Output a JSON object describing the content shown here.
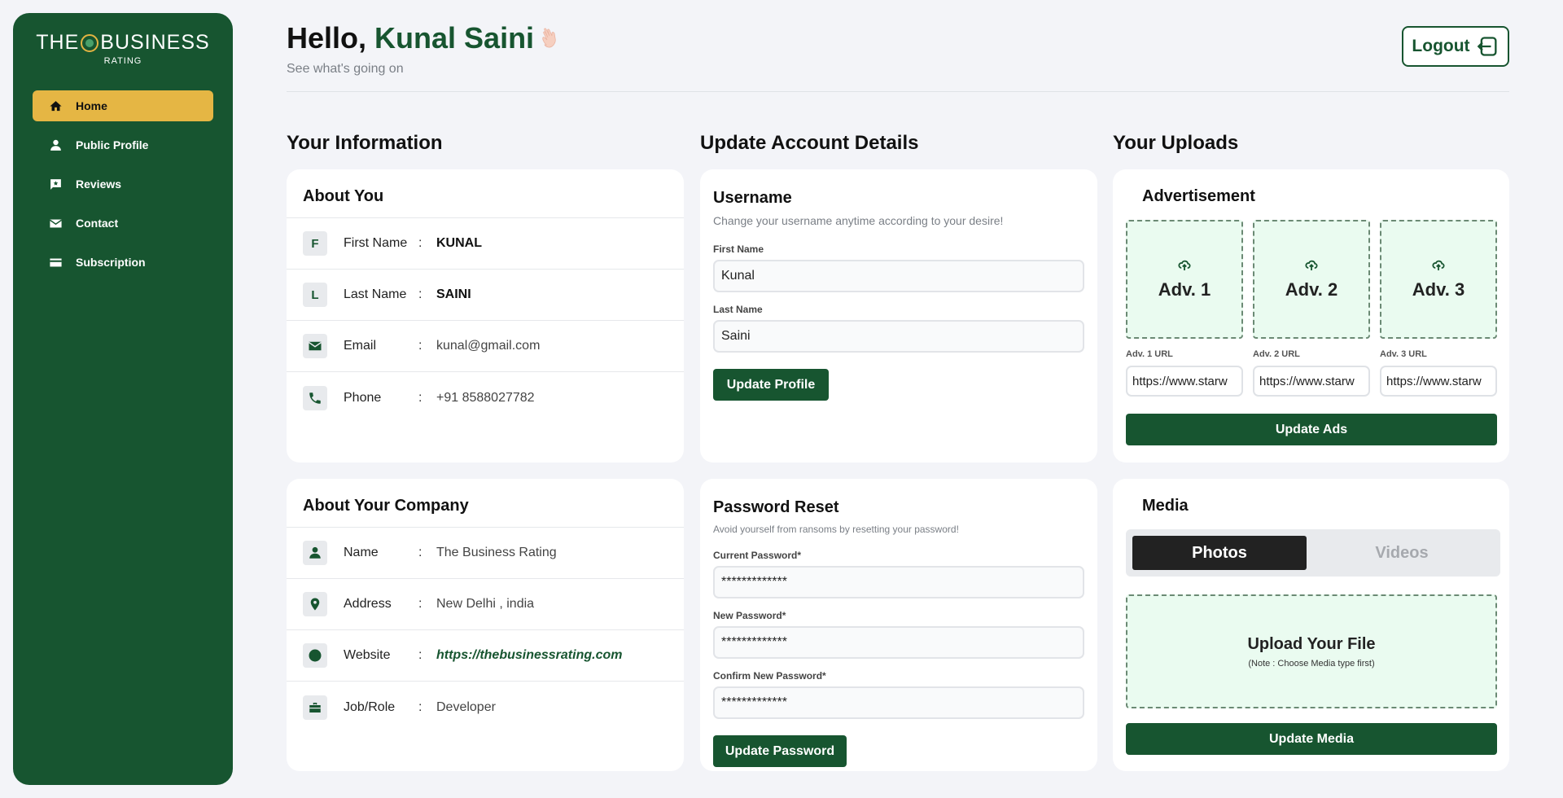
{
  "brand": {
    "name_left": "THE",
    "name_right": "BUSINESS",
    "sub": "RATING"
  },
  "nav": [
    {
      "label": "Home",
      "icon": "home-icon"
    },
    {
      "label": "Public Profile",
      "icon": "person-icon"
    },
    {
      "label": "Reviews",
      "icon": "review-icon"
    },
    {
      "label": "Contact",
      "icon": "mail-icon"
    },
    {
      "label": "Subscription",
      "icon": "card-icon"
    }
  ],
  "header": {
    "greeting": "Hello,",
    "name": "Kunal Saini",
    "subtitle": "See what's going on",
    "logout": "Logout"
  },
  "columns": {
    "info": "Your Information",
    "update": "Update Account Details",
    "uploads": "Your Uploads"
  },
  "about_you": {
    "title": "About You",
    "rows": [
      {
        "badge": "F",
        "label": "First Name",
        "sep": ":",
        "value": "KUNAL"
      },
      {
        "badge": "L",
        "label": "Last Name",
        "sep": ":",
        "value": "SAINI"
      },
      {
        "label": "Email",
        "sep": ":",
        "value": "kunal@gmail.com"
      },
      {
        "label": "Phone",
        "sep": ":",
        "value": "+91 8588027782"
      }
    ]
  },
  "company": {
    "title": "About Your Company",
    "rows": [
      {
        "label": "Name",
        "sep": ":",
        "value": "The Business Rating"
      },
      {
        "label": "Address",
        "sep": ":",
        "value": "New Delhi , india"
      },
      {
        "label": "Website",
        "sep": ":",
        "value": "https://thebusinessrating.com"
      },
      {
        "label": "Job/Role",
        "sep": ":",
        "value": "Developer"
      }
    ]
  },
  "username": {
    "title": "Username",
    "desc": "Change your username anytime according to your desire!",
    "first_label": "First Name",
    "first_value": "Kunal",
    "last_label": "Last Name",
    "last_value": "Saini",
    "button": "Update Profile"
  },
  "password": {
    "title": "Password Reset",
    "desc": "Avoid yourself from ransoms by resetting your password!",
    "current_label": "Current Password*",
    "current_value": "*************",
    "new_label": "New Password*",
    "new_value": "*************",
    "confirm_label": "Confirm New Password*",
    "confirm_value": "*************",
    "button": "Update Password"
  },
  "ads": {
    "title": "Advertisement",
    "items": [
      {
        "label": "Adv. 1",
        "url_label": "Adv. 1 URL",
        "url": "https://www.starw"
      },
      {
        "label": "Adv. 2",
        "url_label": "Adv. 2 URL",
        "url": "https://www.starw"
      },
      {
        "label": "Adv. 3",
        "url_label": "Adv. 3 URL",
        "url": "https://www.starw"
      }
    ],
    "button": "Update Ads"
  },
  "media": {
    "title": "Media",
    "tab_photos": "Photos",
    "tab_videos": "Videos",
    "upload_title": "Upload Your File",
    "upload_note": "(Note : Choose Media type first)",
    "button": "Update Media"
  },
  "colors": {
    "primary": "#175530",
    "accent": "#E5B644",
    "background": "#F3F4F8"
  }
}
